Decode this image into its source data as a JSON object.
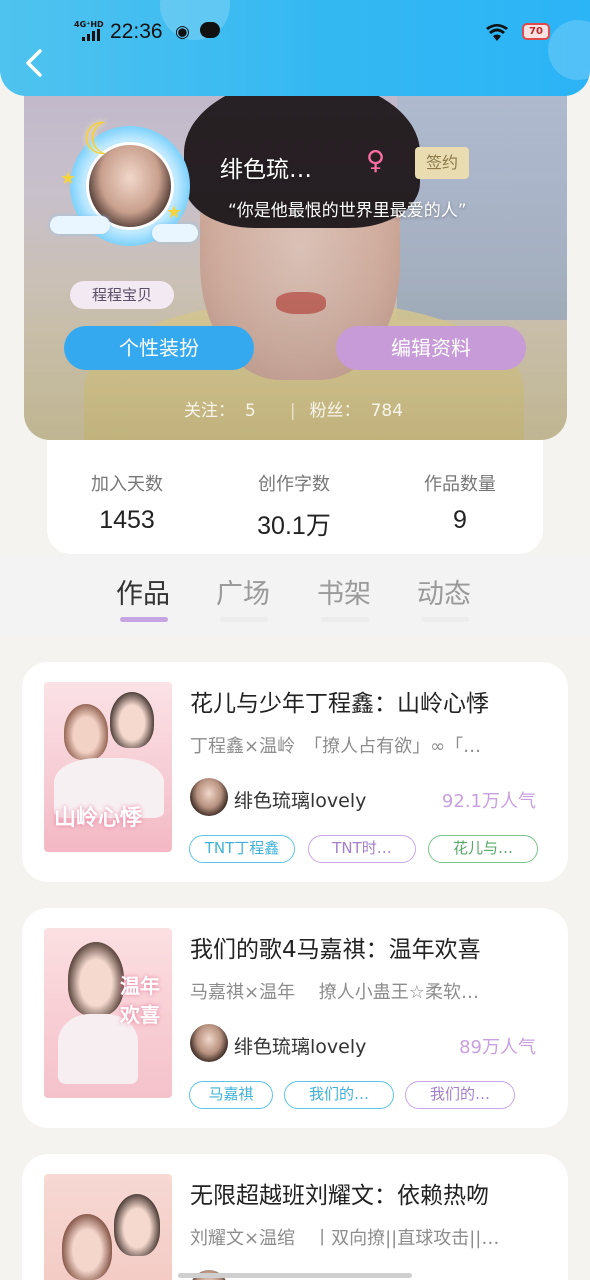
{
  "status_bar": {
    "network": "4G⁺HD",
    "time": "22:36",
    "battery": "70"
  },
  "profile": {
    "nickname": "绯色琉…",
    "gender_symbol": "♀",
    "sign_badge": "签约",
    "quote": "“你是他最恨的世界里最爱的人”",
    "nametag": "程程宝贝",
    "buttons": {
      "dress_up": "个性装扮",
      "edit_profile": "编辑资料"
    },
    "following_label": "关注：",
    "following_count": "5",
    "fans_label": "粉丝：",
    "fans_count": "784"
  },
  "stats": [
    {
      "label": "加入天数",
      "value": "1453"
    },
    {
      "label": "创作字数",
      "value": "30.1万"
    },
    {
      "label": "作品数量",
      "value": "9"
    }
  ],
  "tabs": [
    {
      "label": "作品",
      "active": true
    },
    {
      "label": "广场",
      "active": false
    },
    {
      "label": "书架",
      "active": false
    },
    {
      "label": "动态",
      "active": false
    }
  ],
  "works": [
    {
      "title": "花儿与少年丁程鑫：山岭心悸",
      "desc": "丁程鑫×温岭　「撩人占有欲」∞「…",
      "author": "绯色琉璃lovely",
      "popularity": "92.1万人气",
      "cover_text": "山岭心悸",
      "tags": [
        {
          "text": "TNT丁程鑫",
          "color": "blue"
        },
        {
          "text": "TNT时…",
          "color": "purple"
        },
        {
          "text": "花儿与…",
          "color": "green"
        }
      ]
    },
    {
      "title": "我们的歌4马嘉祺：温年欢喜",
      "desc": "马嘉祺×温年　 撩人小蛊王☆柔软…",
      "author": "绯色琉璃lovely",
      "popularity": "89万人气",
      "cover_text": "温年欢喜",
      "tags": [
        {
          "text": "马嘉祺",
          "color": "blue"
        },
        {
          "text": "我们的…",
          "color": "blue"
        },
        {
          "text": "我们的…",
          "color": "purple"
        }
      ]
    },
    {
      "title": "无限超越班刘耀文：依赖热吻",
      "desc": "刘耀文×温绾　丨双向撩||直球攻击||…",
      "author": "",
      "popularity": "",
      "cover_text": "",
      "tags": []
    }
  ]
}
